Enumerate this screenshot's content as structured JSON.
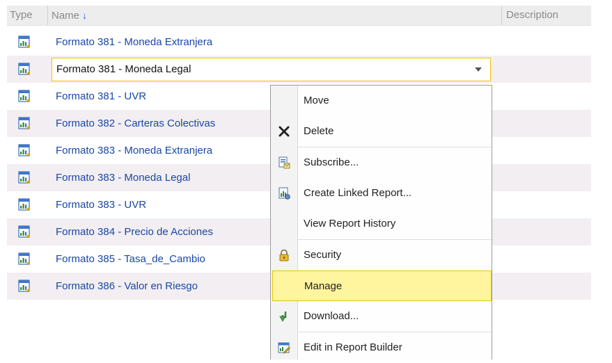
{
  "header": {
    "type_label": "Type",
    "name_label": "Name",
    "sort_arrow": "↓",
    "description_label": "Description"
  },
  "reports": [
    {
      "name": "Formato 381 - Moneda Extranjera"
    },
    {
      "name": "Formato 381 - Moneda Legal"
    },
    {
      "name": "Formato 381 - UVR"
    },
    {
      "name": "Formato 382 - Carteras Colectivas"
    },
    {
      "name": "Formato 383 - Moneda Extranjera"
    },
    {
      "name": "Formato 383 - Moneda Legal"
    },
    {
      "name": "Formato 383 - UVR"
    },
    {
      "name": "Formato 384 - Precio de Acciones"
    },
    {
      "name": "Formato 385 - Tasa_de_Cambio"
    },
    {
      "name": "Formato 386 - Valor en Riesgo"
    }
  ],
  "selected_report": "Formato 381 - Moneda Legal",
  "context_menu": {
    "items": [
      {
        "label": "Move",
        "icon": "none"
      },
      {
        "label": "Delete",
        "icon": "delete-x-icon"
      },
      {
        "label": "Subscribe...",
        "icon": "subscribe-icon"
      },
      {
        "label": "Create Linked Report...",
        "icon": "linked-report-icon"
      },
      {
        "label": "View Report History",
        "icon": "none"
      },
      {
        "label": "Security",
        "icon": "lock-icon"
      },
      {
        "label": "Manage",
        "icon": "none",
        "highlighted": true
      },
      {
        "label": "Download...",
        "icon": "download-arrow-icon"
      },
      {
        "label": "Edit in Report Builder",
        "icon": "report-builder-icon"
      }
    ]
  },
  "colors": {
    "link": "#1a47a6",
    "highlight_bg": "#fff59e",
    "highlight_border": "#e5c600",
    "alt_row": "#f2eef1"
  }
}
